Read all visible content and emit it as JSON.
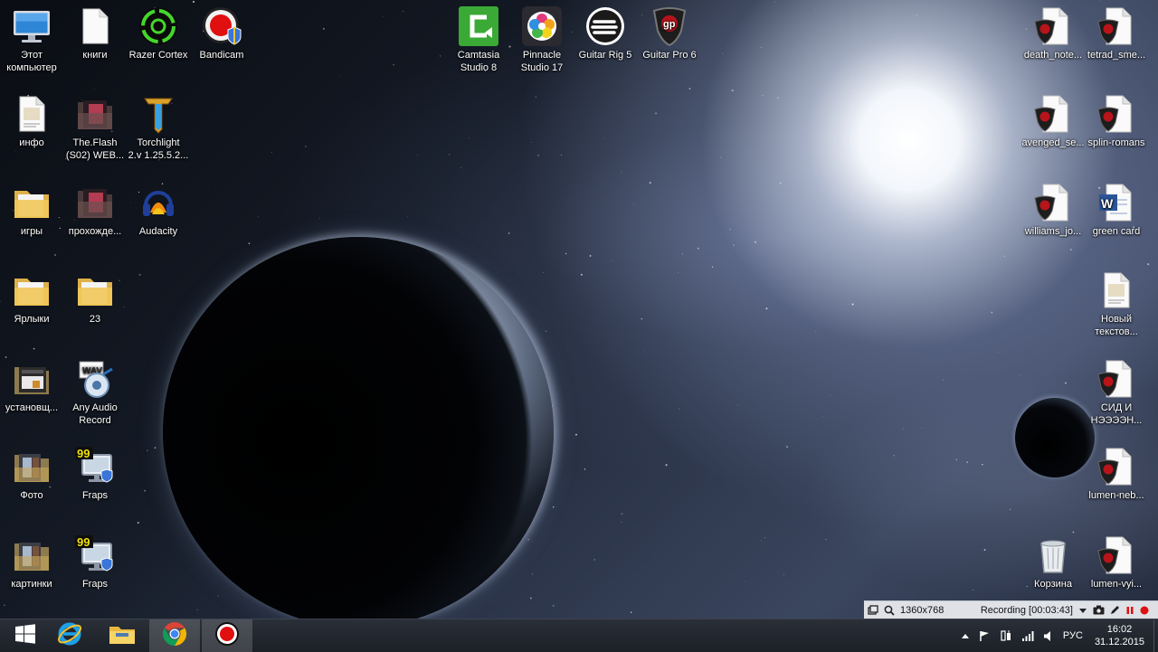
{
  "desktop": {
    "left_icons": [
      {
        "name": "this-pc",
        "label": "Этот\nкомпьютер",
        "icon": "monitor-icon"
      },
      {
        "name": "knigi",
        "label": "книги",
        "icon": "blank-file-icon"
      },
      {
        "name": "razer-cortex",
        "label": "Razer Cortex",
        "icon": "razer-cortex-icon"
      },
      {
        "name": "bandicam",
        "label": "Bandicam",
        "icon": "bandicam-icon"
      },
      {
        "name": "info",
        "label": "инфо",
        "icon": "text-document-icon"
      },
      {
        "name": "the-flash",
        "label": "The.Flash\n(S02) WEB...",
        "icon": "video-folder-icon"
      },
      {
        "name": "torchlight",
        "label": "Torchlight\n2.v 1.25.5.2...",
        "icon": "torchlight-icon"
      },
      {
        "name": "igry",
        "label": "игры",
        "icon": "folder-icon"
      },
      {
        "name": "prokhozhde",
        "label": "прохожде...",
        "icon": "video-folder-icon"
      },
      {
        "name": "audacity",
        "label": "Audacity",
        "icon": "audacity-icon"
      },
      {
        "name": "yarlyki",
        "label": "Ярлыки",
        "icon": "folder-icon"
      },
      {
        "name": "folder-23",
        "label": "23",
        "icon": "folder-icon"
      },
      {
        "name": "ustanovshch",
        "label": "установщ...",
        "icon": "installer-folder-icon"
      },
      {
        "name": "any-audio-record",
        "label": "Any Audio\nRecord",
        "icon": "wav-recorder-icon"
      },
      {
        "name": "foto",
        "label": "Фото",
        "icon": "photo-folder-icon"
      },
      {
        "name": "fraps-1",
        "label": "Fraps",
        "icon": "fraps-icon"
      },
      {
        "name": "kartinki",
        "label": "картинки",
        "icon": "photo-folder-icon"
      },
      {
        "name": "fraps-2",
        "label": "Fraps",
        "icon": "fraps-icon"
      }
    ],
    "top_icons": [
      {
        "name": "camtasia",
        "label": "Camtasia\nStudio 8",
        "icon": "camtasia-icon"
      },
      {
        "name": "pinnacle",
        "label": "Pinnacle\nStudio 17",
        "icon": "pinnacle-icon"
      },
      {
        "name": "guitar-rig",
        "label": "Guitar Rig 5",
        "icon": "guitar-rig-icon"
      },
      {
        "name": "guitar-pro",
        "label": "Guitar Pro 6",
        "icon": "guitar-pro-icon"
      }
    ],
    "right_icons": [
      {
        "name": "death-note",
        "label": "death_note...",
        "icon": "gp-file-icon"
      },
      {
        "name": "tetrad-sme",
        "label": "tetrad_sme...",
        "icon": "gp-file-icon"
      },
      {
        "name": "avenged-se",
        "label": "avenged_se...",
        "icon": "gp-file-icon"
      },
      {
        "name": "splin-romans",
        "label": "splin-romans",
        "icon": "gp-file-icon"
      },
      {
        "name": "williams-jo",
        "label": "williams_jo...",
        "icon": "gp-file-icon"
      },
      {
        "name": "green-card",
        "label": "green card",
        "icon": "word-document-icon"
      },
      {
        "name": "novyi-tekstov",
        "label": "Новый\nтекстов...",
        "icon": "text-document-icon"
      },
      {
        "name": "sid-i-neeeen",
        "label": "СИД И\nНЭЭЭЭН...",
        "icon": "gp-file-icon"
      },
      {
        "name": "lumen-neb",
        "label": "lumen-neb...",
        "icon": "gp-file-icon"
      },
      {
        "name": "korzina",
        "label": "Корзина",
        "icon": "recycle-bin-icon"
      },
      {
        "name": "lumen-vyi",
        "label": "lumen-vyi...",
        "icon": "gp-file-icon"
      }
    ]
  },
  "recorder": {
    "resolution": "1360x768",
    "status": "Recording [00:03:43]"
  },
  "taskbar": {
    "pinned": [
      {
        "name": "start",
        "icon": "windows-logo-icon"
      },
      {
        "name": "internet-explorer",
        "icon": "internet-explorer-icon"
      },
      {
        "name": "file-explorer",
        "icon": "file-explorer-icon"
      },
      {
        "name": "chrome",
        "icon": "chrome-icon"
      },
      {
        "name": "bandicam",
        "icon": "bandicam-icon"
      }
    ],
    "language": "РУС",
    "time": "16:02",
    "date": "31.12.2015"
  },
  "colors": {
    "razer_green": "#44d62c",
    "record_red": "#e01010",
    "chrome_red": "#db4437",
    "chrome_yellow": "#f4b400",
    "chrome_green": "#0f9d58",
    "chrome_blue": "#4285f4",
    "ie_blue": "#1ea0e6",
    "fraps_yellow": "#f4e20c",
    "camtasia_green": "#3aa935",
    "word_blue": "#2b579a"
  }
}
